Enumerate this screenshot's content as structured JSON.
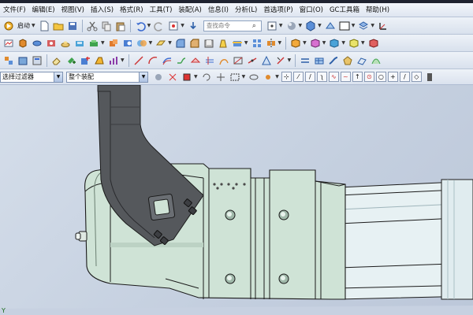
{
  "menu": {
    "items": [
      "文件(F)",
      "编辑(E)",
      "视图(V)",
      "插入(S)",
      "格式(R)",
      "工具(T)",
      "装配(A)",
      "信息(I)",
      "分析(L)",
      "首选项(P)",
      "窗口(O)",
      "GC工具箱",
      "帮助(H)"
    ],
    "search_placeholder": "查找命令"
  },
  "toolbar": {
    "start_label": "启动"
  },
  "selection": {
    "filter_value": "选择过滤器",
    "scope_value": "整个装配"
  },
  "viewport": {
    "axis_label": "Y"
  },
  "colors": {
    "part_green": "#cfe3d6",
    "part_dark": "#55585c",
    "cylinder_blue": "#e7f1f3",
    "edge": "#1b1b1b"
  }
}
